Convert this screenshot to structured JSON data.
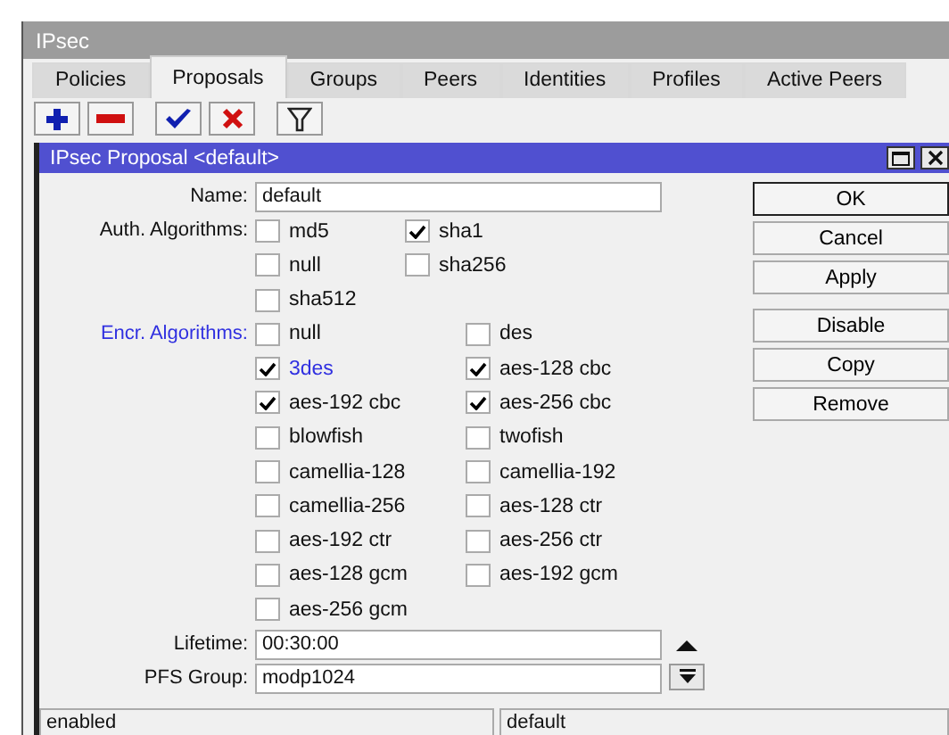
{
  "window": {
    "title": "IPsec"
  },
  "tabs": [
    {
      "label": "Policies",
      "selected": false
    },
    {
      "label": "Proposals",
      "selected": true
    },
    {
      "label": "Groups",
      "selected": false
    },
    {
      "label": "Peers",
      "selected": false
    },
    {
      "label": "Identities",
      "selected": false
    },
    {
      "label": "Profiles",
      "selected": false
    },
    {
      "label": "Active Peers",
      "selected": false
    }
  ],
  "dialog": {
    "title": "IPsec Proposal <default>",
    "name": {
      "label": "Name:",
      "value": "default"
    },
    "auth_algorithms": {
      "label": "Auth. Algorithms:",
      "highlighted": false,
      "options": [
        {
          "label": "md5",
          "checked": false,
          "highlighted": false
        },
        {
          "label": "sha1",
          "checked": true,
          "highlighted": false
        },
        {
          "label": "null",
          "checked": false,
          "highlighted": false
        },
        {
          "label": "sha256",
          "checked": false,
          "highlighted": false
        },
        {
          "label": "sha512",
          "checked": false,
          "highlighted": false
        }
      ]
    },
    "encr_algorithms": {
      "label": "Encr. Algorithms:",
      "highlighted": true,
      "options": [
        {
          "label": "null",
          "checked": false,
          "highlighted": false
        },
        {
          "label": "des",
          "checked": false,
          "highlighted": false
        },
        {
          "label": "3des",
          "checked": true,
          "highlighted": true
        },
        {
          "label": "aes-128 cbc",
          "checked": true,
          "highlighted": false
        },
        {
          "label": "aes-192 cbc",
          "checked": true,
          "highlighted": false
        },
        {
          "label": "aes-256 cbc",
          "checked": true,
          "highlighted": false
        },
        {
          "label": "blowfish",
          "checked": false,
          "highlighted": false
        },
        {
          "label": "twofish",
          "checked": false,
          "highlighted": false
        },
        {
          "label": "camellia-128",
          "checked": false,
          "highlighted": false
        },
        {
          "label": "camellia-192",
          "checked": false,
          "highlighted": false
        },
        {
          "label": "camellia-256",
          "checked": false,
          "highlighted": false
        },
        {
          "label": "aes-128 ctr",
          "checked": false,
          "highlighted": false
        },
        {
          "label": "aes-192 ctr",
          "checked": false,
          "highlighted": false
        },
        {
          "label": "aes-256 ctr",
          "checked": false,
          "highlighted": false
        },
        {
          "label": "aes-128 gcm",
          "checked": false,
          "highlighted": false
        },
        {
          "label": "aes-192 gcm",
          "checked": false,
          "highlighted": false
        },
        {
          "label": "aes-256 gcm",
          "checked": false,
          "highlighted": false
        }
      ]
    },
    "lifetime": {
      "label": "Lifetime:",
      "value": "00:30:00"
    },
    "pfs_group": {
      "label": "PFS Group:",
      "value": "modp1024"
    },
    "buttons": [
      "OK",
      "Cancel",
      "Apply",
      "Disable",
      "Copy",
      "Remove"
    ],
    "status_bar": [
      "enabled",
      "default"
    ]
  }
}
